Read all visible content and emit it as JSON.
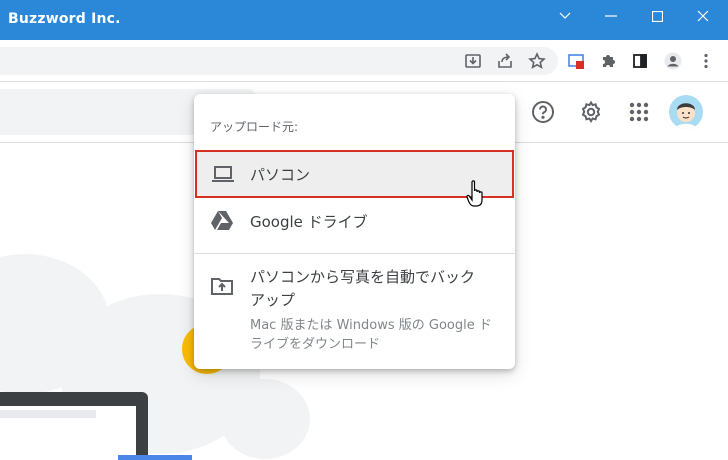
{
  "window": {
    "title": "Buzzword Inc."
  },
  "upload_menu": {
    "header": "アップロード元:",
    "items": [
      {
        "label": "パソコン",
        "icon": "laptop-icon"
      },
      {
        "label": "Google ドライブ",
        "icon": "google-drive-icon"
      }
    ],
    "backup": {
      "title_line1": "パソコンから写真を自動でバック",
      "title_line2": "アップ",
      "desc_line1": "Mac 版または Windows 版の Google ド",
      "desc_line2": "ライブをダウンロード",
      "icon": "folder-upload-icon"
    }
  },
  "colors": {
    "titlebar": "#2b88d8",
    "selection_border": "#d93025",
    "accent_blue": "#4a86e8"
  }
}
